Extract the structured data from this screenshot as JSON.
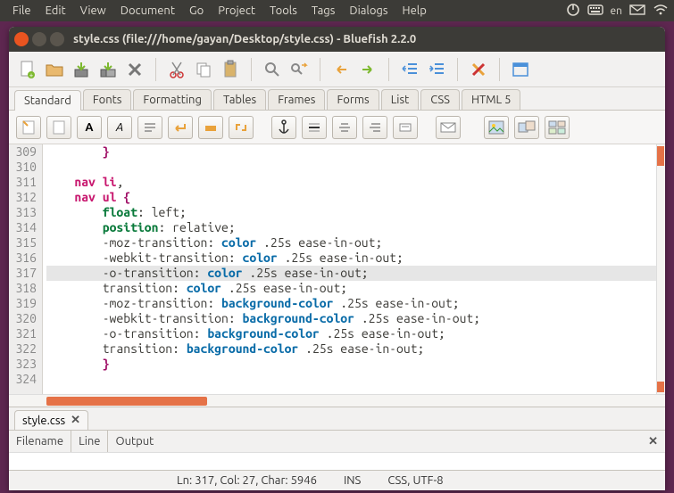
{
  "menubar": {
    "items": [
      "File",
      "Edit",
      "View",
      "Document",
      "Go",
      "Project",
      "Tools",
      "Tags",
      "Dialogs",
      "Help"
    ],
    "lang": "en"
  },
  "window": {
    "title": "style.css (file:///home/gayan/Desktop/style.css) - Bluefish 2.2.0"
  },
  "tabs": [
    "Standard",
    "Fonts",
    "Formatting",
    "Tables",
    "Frames",
    "Forms",
    "List",
    "CSS",
    "HTML 5"
  ],
  "active_tab": 0,
  "code_lines": [
    {
      "n": 309,
      "seg": [
        {
          "t": "        ",
          "c": "txt"
        },
        {
          "t": "}",
          "c": "br"
        }
      ]
    },
    {
      "n": 310,
      "seg": []
    },
    {
      "n": 311,
      "seg": [
        {
          "t": "    ",
          "c": "txt"
        },
        {
          "t": "nav li",
          "c": "sel"
        },
        {
          "t": ",",
          "c": "txt"
        }
      ]
    },
    {
      "n": 312,
      "seg": [
        {
          "t": "    ",
          "c": "txt"
        },
        {
          "t": "nav ul ",
          "c": "sel"
        },
        {
          "t": "{",
          "c": "br"
        }
      ]
    },
    {
      "n": 313,
      "seg": [
        {
          "t": "        ",
          "c": "txt"
        },
        {
          "t": "float",
          "c": "prop"
        },
        {
          "t": ": left;",
          "c": "txt"
        }
      ]
    },
    {
      "n": 314,
      "seg": [
        {
          "t": "        ",
          "c": "txt"
        },
        {
          "t": "position",
          "c": "prop"
        },
        {
          "t": ": relative;",
          "c": "txt"
        }
      ]
    },
    {
      "n": 315,
      "seg": [
        {
          "t": "        -moz-transition: ",
          "c": "txt"
        },
        {
          "t": "color",
          "c": "val"
        },
        {
          "t": " .25s ease-in-out;",
          "c": "txt"
        }
      ]
    },
    {
      "n": 316,
      "seg": [
        {
          "t": "        -webkit-transition: ",
          "c": "txt"
        },
        {
          "t": "color",
          "c": "val"
        },
        {
          "t": " .25s ease-in-out;",
          "c": "txt"
        }
      ]
    },
    {
      "n": 317,
      "hl": true,
      "seg": [
        {
          "t": "        -o-transition: ",
          "c": "txt"
        },
        {
          "t": "color",
          "c": "val"
        },
        {
          "t": " .25s ease-in-out;",
          "c": "txt"
        }
      ]
    },
    {
      "n": 318,
      "seg": [
        {
          "t": "        transition: ",
          "c": "txt"
        },
        {
          "t": "color",
          "c": "val"
        },
        {
          "t": " .25s ease-in-out;",
          "c": "txt"
        }
      ]
    },
    {
      "n": 319,
      "seg": [
        {
          "t": "        -moz-transition: ",
          "c": "txt"
        },
        {
          "t": "background-color",
          "c": "val"
        },
        {
          "t": " .25s ease-in-out;",
          "c": "txt"
        }
      ]
    },
    {
      "n": 320,
      "seg": [
        {
          "t": "        -webkit-transition: ",
          "c": "txt"
        },
        {
          "t": "background-color",
          "c": "val"
        },
        {
          "t": " .25s ease-in-out;",
          "c": "txt"
        }
      ]
    },
    {
      "n": 321,
      "seg": [
        {
          "t": "        -o-transition: ",
          "c": "txt"
        },
        {
          "t": "background-color",
          "c": "val"
        },
        {
          "t": " .25s ease-in-out;",
          "c": "txt"
        }
      ]
    },
    {
      "n": 322,
      "seg": [
        {
          "t": "        transition: ",
          "c": "txt"
        },
        {
          "t": "background-color",
          "c": "val"
        },
        {
          "t": " .25s ease-in-out;",
          "c": "txt"
        }
      ]
    },
    {
      "n": 323,
      "seg": [
        {
          "t": "        ",
          "c": "txt"
        },
        {
          "t": "}",
          "c": "br"
        }
      ]
    },
    {
      "n": 324,
      "seg": []
    }
  ],
  "file_tab": {
    "name": "style.css"
  },
  "output": {
    "cols": [
      "Filename",
      "Line",
      "Output"
    ]
  },
  "status": {
    "pos": "Ln: 317, Col: 27, Char: 5946",
    "ins": "INS",
    "mode": "CSS, UTF-8"
  }
}
